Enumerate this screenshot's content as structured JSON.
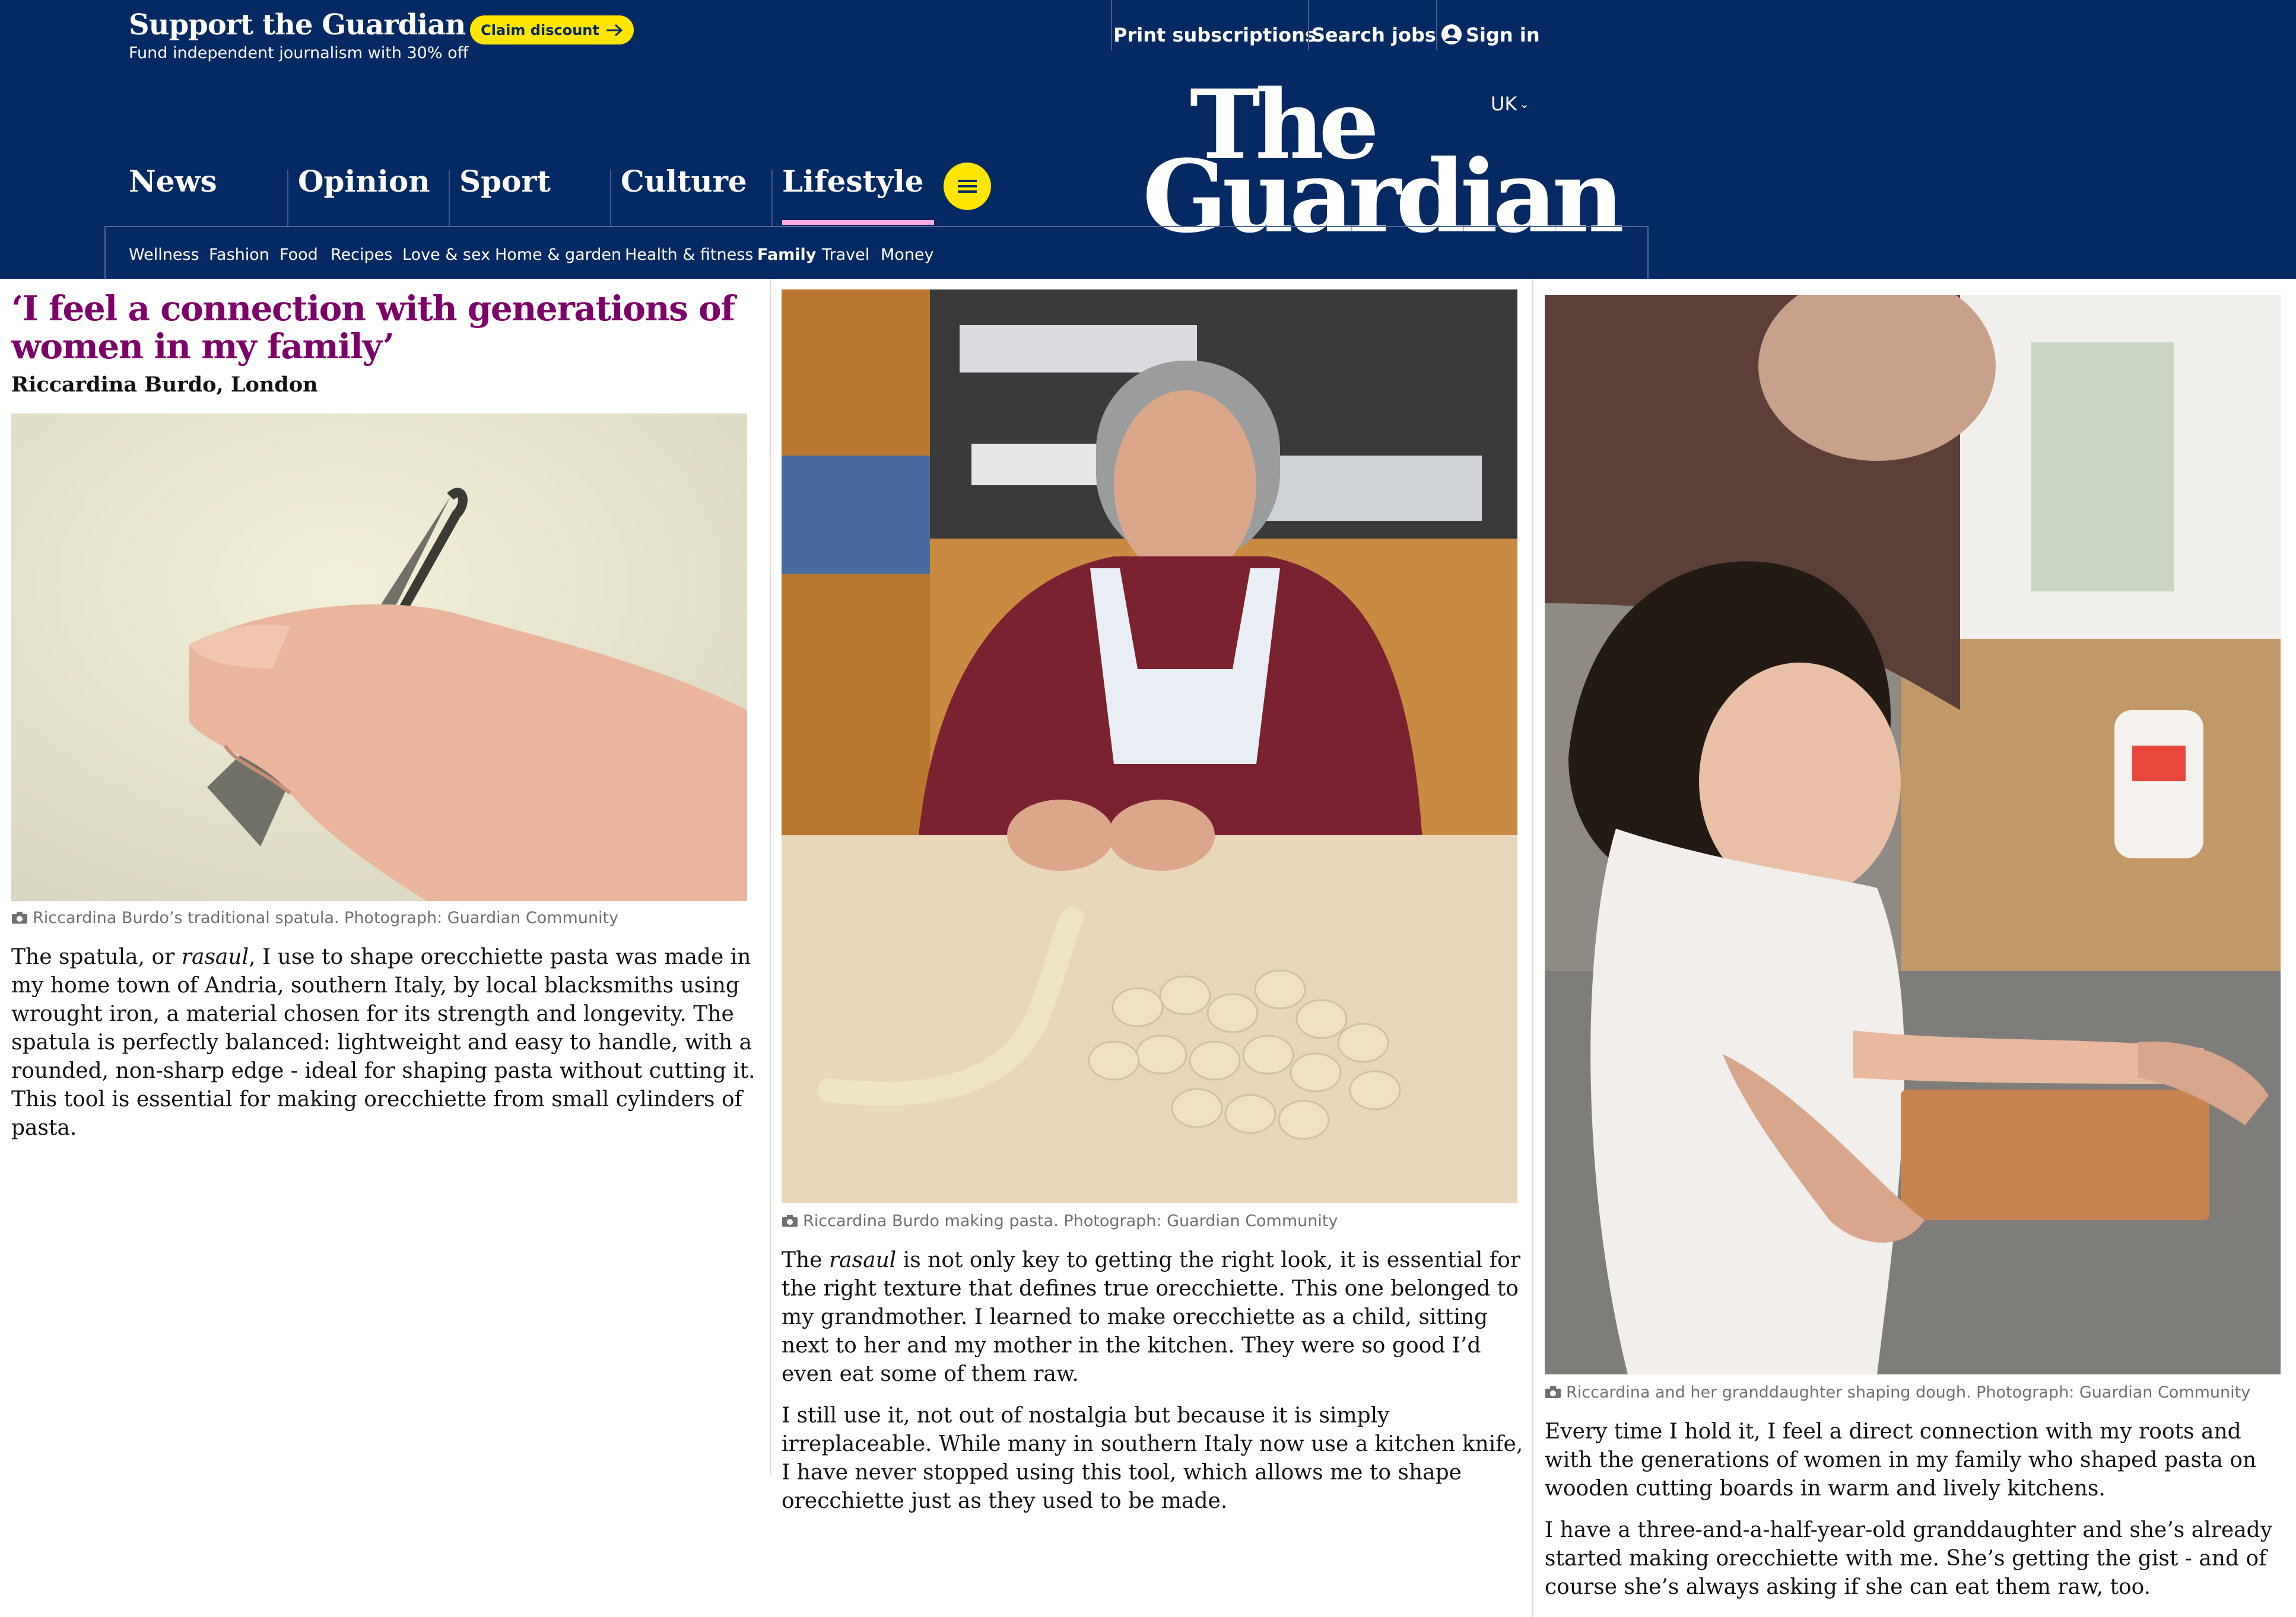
{
  "support": {
    "title": "Support the Guardian",
    "subtitle": "Fund independent journalism with 30% off",
    "claim_label": "Claim discount"
  },
  "top_links": {
    "print": "Print subscriptions",
    "jobs": "Search jobs",
    "signin": "Sign in"
  },
  "masthead": {
    "logo_line1": "The",
    "logo_line2": "Guardian",
    "edition": "UK"
  },
  "nav": {
    "pillars": [
      "News",
      "Opinion",
      "Sport",
      "Culture",
      "Lifestyle"
    ],
    "active_pillar": "Lifestyle",
    "subnav": [
      "Wellness",
      "Fashion",
      "Food",
      "Recipes",
      "Love & sex",
      "Home & garden",
      "Health & fitness",
      "Family",
      "Travel",
      "Money"
    ],
    "active_subnav": "Family"
  },
  "article": {
    "headline": "‘I feel a connection with generations of women in my family’",
    "byline": "Riccardina Burdo, London",
    "col1": {
      "caption": "Riccardina Burdo’s traditional spatula. Photograph: Guardian Community",
      "p1_a": "The spatula, or ",
      "p1_em": "rasaul",
      "p1_b": ", I use to shape orecchiette pasta was made in my home town of Andria, southern Italy, by local blacksmiths using wrought iron, a material chosen for its strength and longevity. The spatula is perfectly balanced: lightweight and easy to handle, with a rounded, non-sharp edge - ideal for shaping pasta without cutting it. This tool is essential for making orecchiette from small cylinders of pasta."
    },
    "col2": {
      "caption": "Riccardina Burdo making pasta. Photograph: Guardian Community",
      "p1_a": "The ",
      "p1_em": "rasaul",
      "p1_b": " is not only key to getting the right look, it is essential for the right texture that defines true orecchiette. This one belonged to my grandmother. I learned to make orecchiette as a child, sitting next to her and my mother in the kitchen. They were so good I’d even eat some of them raw.",
      "p2": "I still use it, not out of nostalgia but because it is simply irreplaceable. While many in southern Italy now use a kitchen knife, I have never stopped using this tool, which allows me to shape orecchiette just as they used to be made."
    },
    "col3": {
      "caption": "Riccardina and her granddaughter shaping dough. Photograph: Guardian Community",
      "p1": "Every time I hold it, I feel a direct connection with my roots and with the generations of women in my family who shaped pasta on wooden cutting boards in warm and lively kitchens.",
      "p2": "I have a three-and-a-half-year-old granddaughter and she’s already started making orecchiette with me. She’s getting the gist - and of course she’s always asking if she can eat them raw, too."
    }
  },
  "colors": {
    "brand_blue": "#052962",
    "yellow": "#ffe500",
    "lifestyle_pink": "#ffabdb",
    "headline_purple": "#7d0068"
  }
}
